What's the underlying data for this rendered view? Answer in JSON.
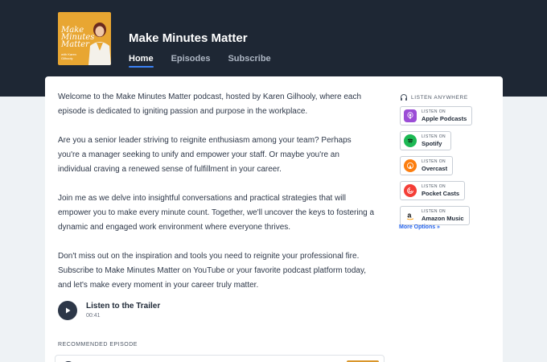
{
  "header": {
    "show_title": "Make Minutes Matter",
    "cover": {
      "title": "Make Minutes Matter",
      "subtitle": "with Karen Gilhooly"
    },
    "tabs": [
      {
        "label": "Home",
        "active": true
      },
      {
        "label": "Episodes",
        "active": false
      },
      {
        "label": "Subscribe",
        "active": false
      }
    ]
  },
  "description": [
    "Welcome to the Make Minutes Matter podcast, hosted by Karen Gilhooly, where each episode is dedicated to igniting passion and purpose in the workplace.",
    "Are you a senior leader striving to reignite enthusiasm among your team? Perhaps you're a manager seeking to unify and empower your staff. Or maybe you're an individual craving a renewed sense of fulfillment in your career.",
    "Join me as we delve into insightful conversations and practical strategies that will empower you to make every minute count. Together, we'll uncover the keys to fostering a dynamic and engaged work environment where everyone thrives.",
    "Don't miss out on the inspiration and tools you need to reignite your professional fire. Subscribe to Make Minutes Matter on YouTube or your favorite podcast platform today, and let's make every moment in your career truly matter."
  ],
  "trailer": {
    "label": "Listen to the Trailer",
    "duration": "00:41"
  },
  "recommended": {
    "heading": "RECOMMENDED EPISODE"
  },
  "listen": {
    "heading": "LISTEN ANYWHERE",
    "platforms": [
      {
        "small": "LISTEN ON",
        "name": "Apple Podcasts",
        "icon": "apple-podcasts-icon",
        "color": "#9b4dd6"
      },
      {
        "small": "LISTEN ON",
        "name": "Spotify",
        "icon": "spotify-icon",
        "color": "#1db954"
      },
      {
        "small": "LISTEN ON",
        "name": "Overcast",
        "icon": "overcast-icon",
        "color": "#fc7e0f"
      },
      {
        "small": "LISTEN ON",
        "name": "Pocket Casts",
        "icon": "pocket-casts-icon",
        "color": "#f43e37"
      },
      {
        "small": "LISTEN ON",
        "name": "Amazon Music",
        "icon": "amazon-music-icon",
        "color": "#232f3e"
      }
    ],
    "more": "More Options »"
  },
  "colors": {
    "header_bg": "#1e2734",
    "accent": "#3b82f6",
    "link": "#2563eb"
  }
}
